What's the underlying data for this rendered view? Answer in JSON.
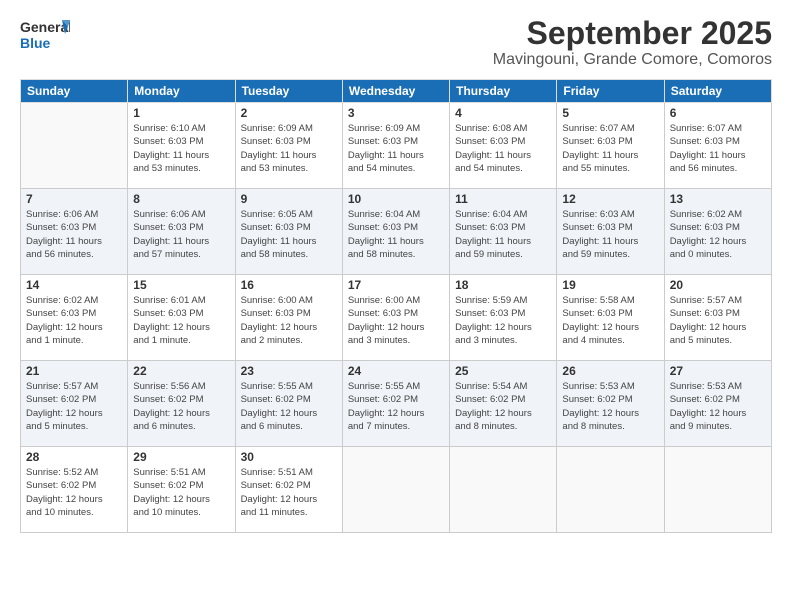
{
  "logo": {
    "line1": "General",
    "line2": "Blue"
  },
  "title": "September 2025",
  "location": "Mavingouni, Grande Comore, Comoros",
  "headers": [
    "Sunday",
    "Monday",
    "Tuesday",
    "Wednesday",
    "Thursday",
    "Friday",
    "Saturday"
  ],
  "weeks": [
    [
      {
        "day": "",
        "info": ""
      },
      {
        "day": "1",
        "info": "Sunrise: 6:10 AM\nSunset: 6:03 PM\nDaylight: 11 hours\nand 53 minutes."
      },
      {
        "day": "2",
        "info": "Sunrise: 6:09 AM\nSunset: 6:03 PM\nDaylight: 11 hours\nand 53 minutes."
      },
      {
        "day": "3",
        "info": "Sunrise: 6:09 AM\nSunset: 6:03 PM\nDaylight: 11 hours\nand 54 minutes."
      },
      {
        "day": "4",
        "info": "Sunrise: 6:08 AM\nSunset: 6:03 PM\nDaylight: 11 hours\nand 54 minutes."
      },
      {
        "day": "5",
        "info": "Sunrise: 6:07 AM\nSunset: 6:03 PM\nDaylight: 11 hours\nand 55 minutes."
      },
      {
        "day": "6",
        "info": "Sunrise: 6:07 AM\nSunset: 6:03 PM\nDaylight: 11 hours\nand 56 minutes."
      }
    ],
    [
      {
        "day": "7",
        "info": "Sunrise: 6:06 AM\nSunset: 6:03 PM\nDaylight: 11 hours\nand 56 minutes."
      },
      {
        "day": "8",
        "info": "Sunrise: 6:06 AM\nSunset: 6:03 PM\nDaylight: 11 hours\nand 57 minutes."
      },
      {
        "day": "9",
        "info": "Sunrise: 6:05 AM\nSunset: 6:03 PM\nDaylight: 11 hours\nand 58 minutes."
      },
      {
        "day": "10",
        "info": "Sunrise: 6:04 AM\nSunset: 6:03 PM\nDaylight: 11 hours\nand 58 minutes."
      },
      {
        "day": "11",
        "info": "Sunrise: 6:04 AM\nSunset: 6:03 PM\nDaylight: 11 hours\nand 59 minutes."
      },
      {
        "day": "12",
        "info": "Sunrise: 6:03 AM\nSunset: 6:03 PM\nDaylight: 11 hours\nand 59 minutes."
      },
      {
        "day": "13",
        "info": "Sunrise: 6:02 AM\nSunset: 6:03 PM\nDaylight: 12 hours\nand 0 minutes."
      }
    ],
    [
      {
        "day": "14",
        "info": "Sunrise: 6:02 AM\nSunset: 6:03 PM\nDaylight: 12 hours\nand 1 minute."
      },
      {
        "day": "15",
        "info": "Sunrise: 6:01 AM\nSunset: 6:03 PM\nDaylight: 12 hours\nand 1 minute."
      },
      {
        "day": "16",
        "info": "Sunrise: 6:00 AM\nSunset: 6:03 PM\nDaylight: 12 hours\nand 2 minutes."
      },
      {
        "day": "17",
        "info": "Sunrise: 6:00 AM\nSunset: 6:03 PM\nDaylight: 12 hours\nand 3 minutes."
      },
      {
        "day": "18",
        "info": "Sunrise: 5:59 AM\nSunset: 6:03 PM\nDaylight: 12 hours\nand 3 minutes."
      },
      {
        "day": "19",
        "info": "Sunrise: 5:58 AM\nSunset: 6:03 PM\nDaylight: 12 hours\nand 4 minutes."
      },
      {
        "day": "20",
        "info": "Sunrise: 5:57 AM\nSunset: 6:03 PM\nDaylight: 12 hours\nand 5 minutes."
      }
    ],
    [
      {
        "day": "21",
        "info": "Sunrise: 5:57 AM\nSunset: 6:02 PM\nDaylight: 12 hours\nand 5 minutes."
      },
      {
        "day": "22",
        "info": "Sunrise: 5:56 AM\nSunset: 6:02 PM\nDaylight: 12 hours\nand 6 minutes."
      },
      {
        "day": "23",
        "info": "Sunrise: 5:55 AM\nSunset: 6:02 PM\nDaylight: 12 hours\nand 6 minutes."
      },
      {
        "day": "24",
        "info": "Sunrise: 5:55 AM\nSunset: 6:02 PM\nDaylight: 12 hours\nand 7 minutes."
      },
      {
        "day": "25",
        "info": "Sunrise: 5:54 AM\nSunset: 6:02 PM\nDaylight: 12 hours\nand 8 minutes."
      },
      {
        "day": "26",
        "info": "Sunrise: 5:53 AM\nSunset: 6:02 PM\nDaylight: 12 hours\nand 8 minutes."
      },
      {
        "day": "27",
        "info": "Sunrise: 5:53 AM\nSunset: 6:02 PM\nDaylight: 12 hours\nand 9 minutes."
      }
    ],
    [
      {
        "day": "28",
        "info": "Sunrise: 5:52 AM\nSunset: 6:02 PM\nDaylight: 12 hours\nand 10 minutes."
      },
      {
        "day": "29",
        "info": "Sunrise: 5:51 AM\nSunset: 6:02 PM\nDaylight: 12 hours\nand 10 minutes."
      },
      {
        "day": "30",
        "info": "Sunrise: 5:51 AM\nSunset: 6:02 PM\nDaylight: 12 hours\nand 11 minutes."
      },
      {
        "day": "",
        "info": ""
      },
      {
        "day": "",
        "info": ""
      },
      {
        "day": "",
        "info": ""
      },
      {
        "day": "",
        "info": ""
      }
    ]
  ]
}
